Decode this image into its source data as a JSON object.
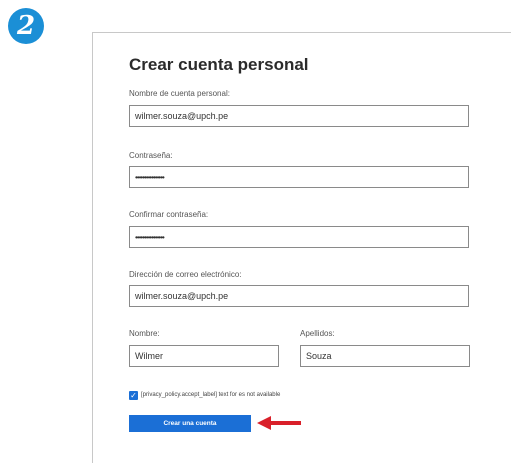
{
  "step": {
    "number": "2",
    "color": "#1b8fd6"
  },
  "form": {
    "title": "Crear cuenta personal",
    "account_name": {
      "label": "Nombre de cuenta personal:",
      "value": "wilmer.souza@upch.pe"
    },
    "password": {
      "label": "Contraseña:",
      "value": "••••••••••••••••"
    },
    "confirm_password": {
      "label": "Confirmar contraseña:",
      "value": "••••••••••••••••"
    },
    "email": {
      "label": "Dirección de correo electrónico:",
      "value": "wilmer.souza@upch.pe"
    },
    "first_name": {
      "label": "Nombre:",
      "value": "Wilmer"
    },
    "last_name": {
      "label": "Apellidos:",
      "value": "Souza"
    },
    "privacy": {
      "checked": true,
      "text": "[privacy_policy.accept_label] text for es not available"
    },
    "submit_label": "Crear una cuenta"
  },
  "colors": {
    "accent": "#1b6fd6",
    "arrow": "#d9202a"
  }
}
